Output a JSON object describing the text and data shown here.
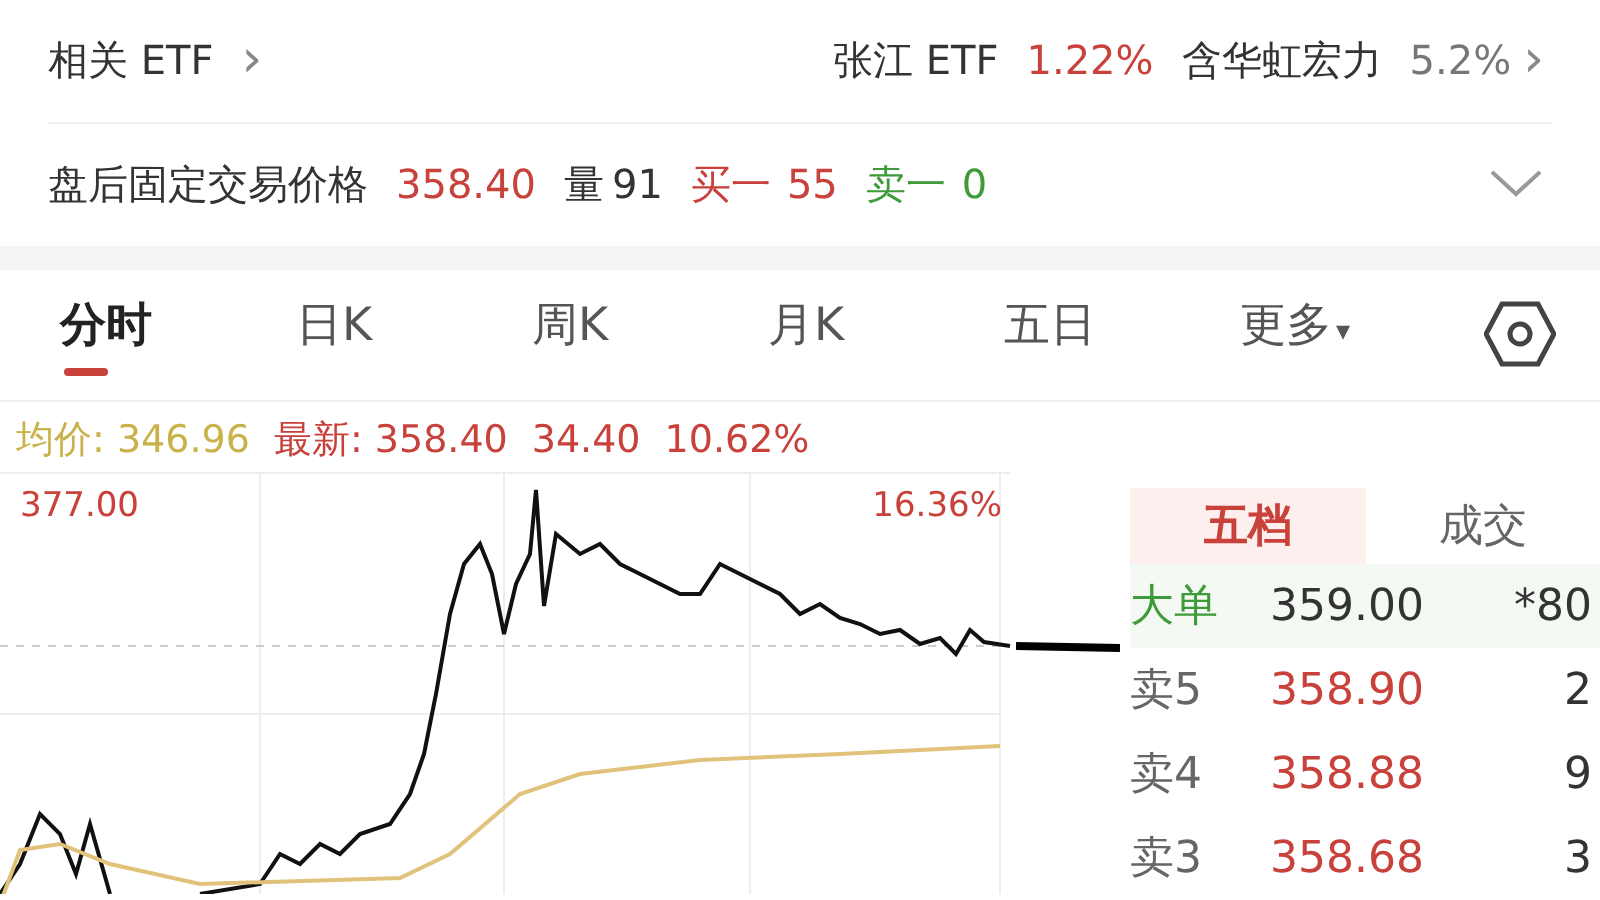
{
  "related_etf": {
    "label": "相关 ETF",
    "chevron": "›",
    "items": [
      {
        "name": "张江 ETF",
        "change": "1.22%",
        "color": "#c8413b"
      },
      {
        "name": "含华虹宏力",
        "change": "5.2%",
        "color": "#777777"
      }
    ],
    "more": "›"
  },
  "after_hours": {
    "label": "盘后固定交易价格",
    "price": "358.40",
    "volume_label": "量",
    "volume": "91",
    "bid_label": "买一",
    "bid": "55",
    "ask_label": "卖一",
    "ask": "0",
    "expanded": false
  },
  "tabs": [
    {
      "label": "分时",
      "selected": true
    },
    {
      "label": "日K",
      "selected": false
    },
    {
      "label": "周K",
      "selected": false
    },
    {
      "label": "月K",
      "selected": false
    },
    {
      "label": "五日",
      "selected": false
    },
    {
      "label": "更多",
      "selected": false,
      "caret": "▾"
    }
  ],
  "stats": {
    "avg_label": "均价:",
    "avg": "346.96",
    "latest_label": "最新:",
    "latest": "358.40",
    "change": "34.40",
    "change_pct": "10.62%"
  },
  "chart": {
    "top_price": "377.00",
    "top_pct": "16.36%"
  },
  "order_book": {
    "tabs": [
      {
        "label": "五档",
        "selected": true
      },
      {
        "label": "成交",
        "selected": false
      }
    ],
    "big_order": {
      "label": "大单",
      "price": "359.00",
      "qty": "*80"
    },
    "rows": [
      {
        "label": "卖5",
        "price": "358.90",
        "qty": "2"
      },
      {
        "label": "卖4",
        "price": "358.88",
        "qty": "9"
      },
      {
        "label": "卖3",
        "price": "358.68",
        "qty": "3"
      }
    ]
  }
}
